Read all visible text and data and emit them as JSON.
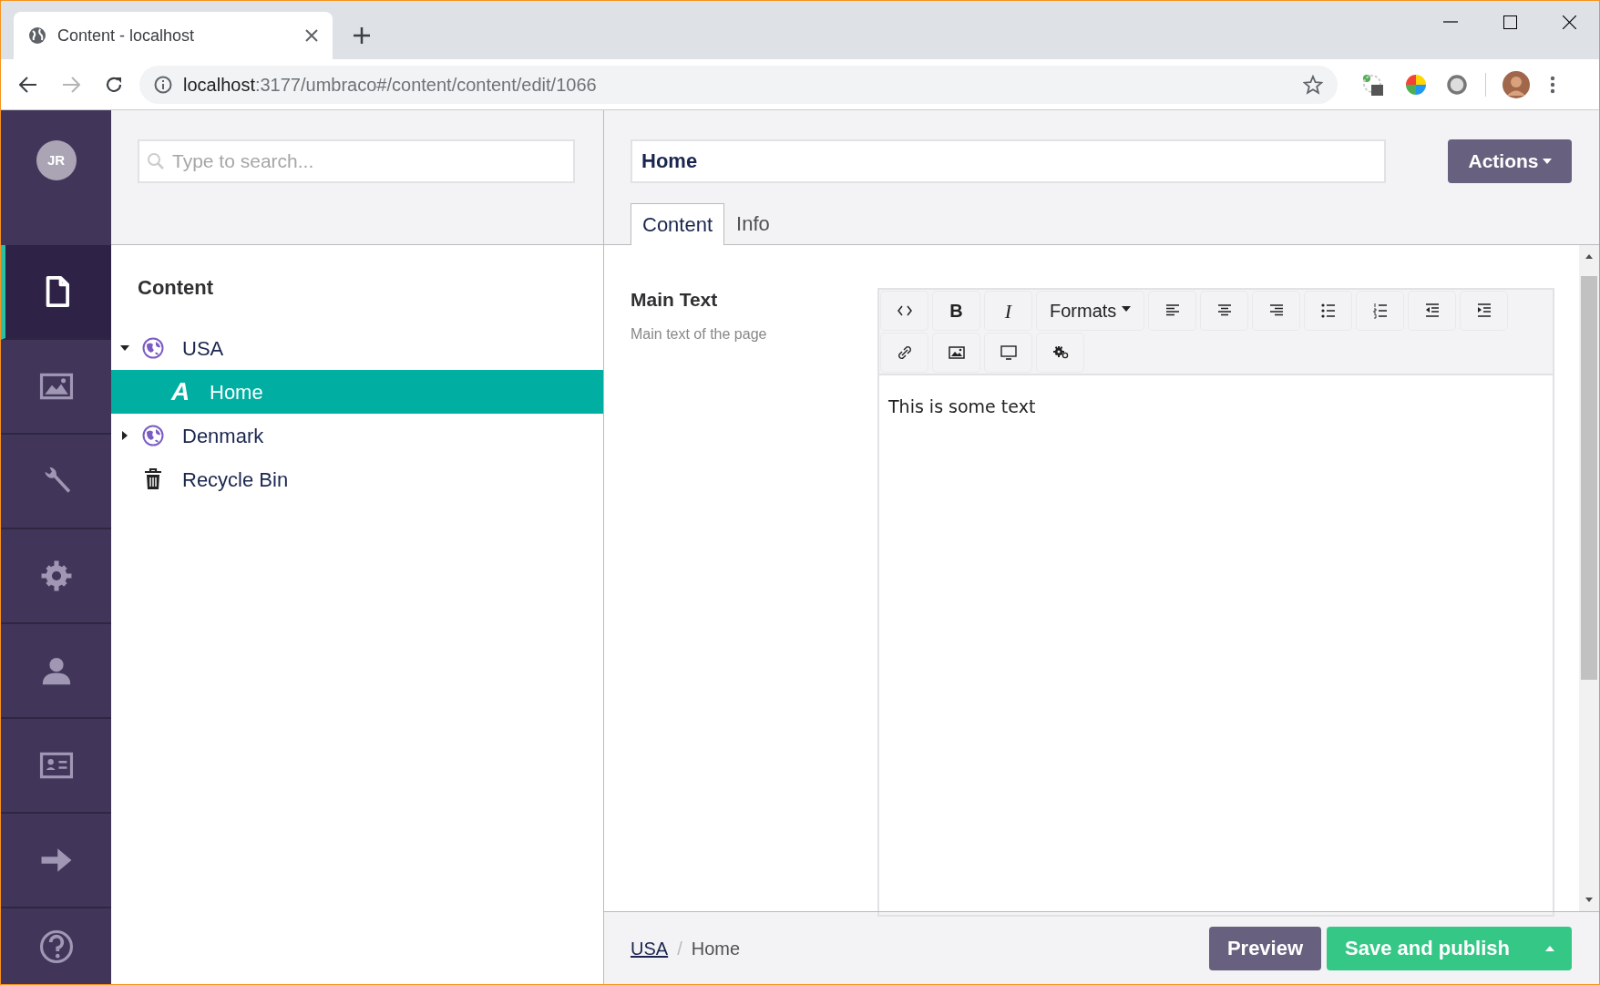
{
  "browser": {
    "tab_title": "Content - localhost",
    "address_host": "localhost",
    "address_path": ":3177/umbraco#/content/content/edit/1066"
  },
  "sidebar": {
    "avatar": "JR",
    "sections": [
      {
        "kind": "document",
        "selected": true
      },
      {
        "kind": "image",
        "selected": false
      },
      {
        "kind": "wrench",
        "selected": false
      },
      {
        "kind": "gear",
        "selected": false
      },
      {
        "kind": "user",
        "selected": false
      },
      {
        "kind": "card",
        "selected": false
      },
      {
        "kind": "arrow",
        "selected": false
      },
      {
        "kind": "help",
        "selected": false
      }
    ]
  },
  "tree": {
    "search": {
      "placeholder": "Type to search..."
    },
    "title": "Content",
    "nodes": [
      {
        "label": "USA",
        "kind": "globe",
        "expanded": true,
        "selected": false,
        "children": [
          {
            "label": "Home",
            "kind": "document",
            "glyph": "A",
            "selected": true
          }
        ]
      },
      {
        "label": "Denmark",
        "kind": "globe",
        "expanded": false,
        "selected": false
      },
      {
        "label": "Recycle Bin",
        "kind": "bin",
        "selected": false
      }
    ]
  },
  "editor": {
    "name": "Home",
    "actions": "Actions",
    "tabs": [
      {
        "label": "Content",
        "selected": true
      },
      {
        "label": "Info",
        "selected": false
      }
    ],
    "property": {
      "label": "Main Text",
      "description": "Main text of the page"
    },
    "toolbar": [
      [
        {
          "kind": "code"
        },
        {
          "kind": "bold",
          "label": "B"
        },
        {
          "kind": "italic",
          "label": "I"
        },
        {
          "kind": "dropdown",
          "label": "Formats"
        },
        {
          "kind": "align-left"
        },
        {
          "kind": "align-center"
        },
        {
          "kind": "align-right"
        },
        {
          "kind": "bullets"
        },
        {
          "kind": "numbers"
        },
        {
          "kind": "outdent"
        },
        {
          "kind": "indent"
        }
      ],
      [
        {
          "kind": "link"
        },
        {
          "kind": "image"
        },
        {
          "kind": "monitor"
        },
        {
          "kind": "gears"
        }
      ]
    ],
    "body": "This is some text"
  },
  "footer": {
    "breadcrumb": [
      {
        "label": "USA",
        "link": true
      },
      {
        "label": "Home",
        "link": false
      }
    ],
    "separator": "/",
    "preview": "Preview",
    "publish": "Save and publish"
  }
}
